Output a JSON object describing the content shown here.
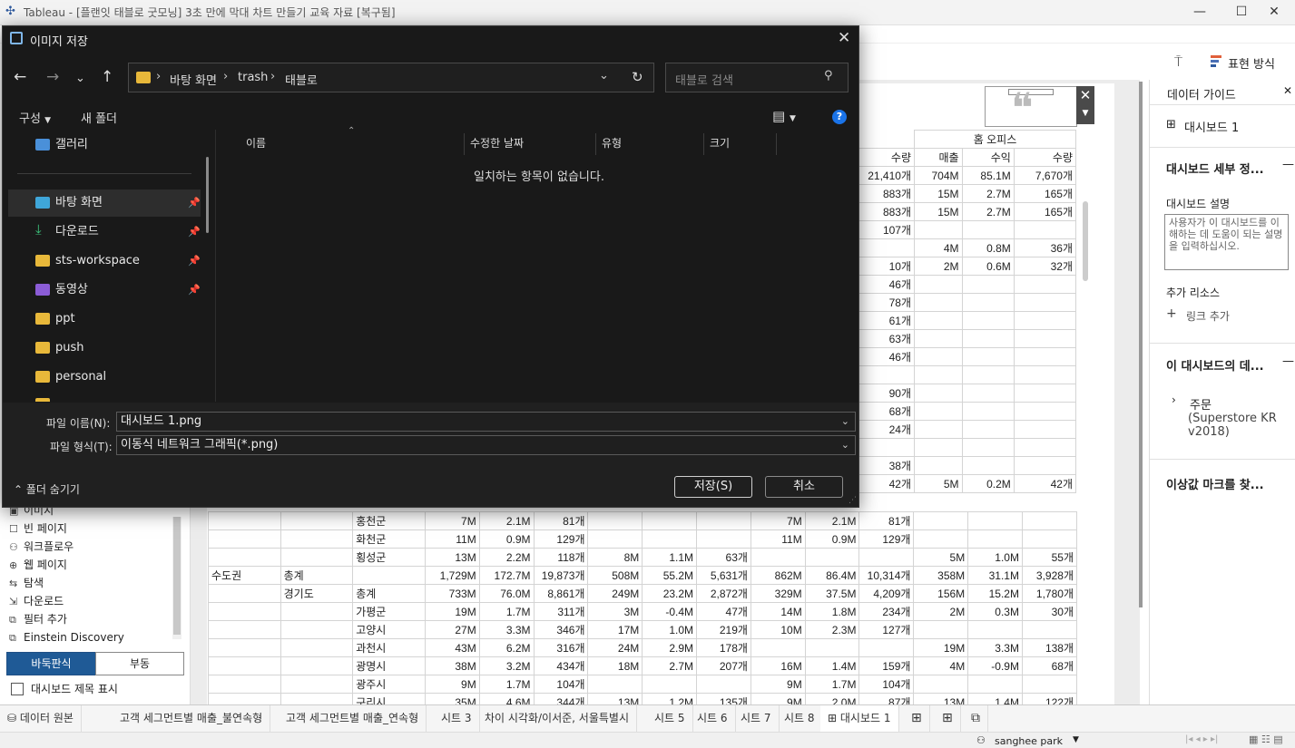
{
  "window": {
    "title": "Tableau - [플랜잇 태블로 굿모닝] 3초 만에 막대 차트 만들기 교육 자료 [복구됨]",
    "controls": [
      "—",
      "☐",
      "✕"
    ]
  },
  "toolbar": {
    "present_label": "표현 방식"
  },
  "left_pane": {
    "objects": [
      "이미지",
      "빈 페이지",
      "워크플로우",
      "웹 페이지",
      "탐색",
      "다운로드",
      "필터 추가",
      "Einstein Discovery"
    ],
    "tiled": "바둑판식",
    "floating": "부동",
    "show_title": "대시보드 제목 표시"
  },
  "table": {
    "group_header": "홈 오피스",
    "col_headers": [
      "수량",
      "매출",
      "수익",
      "수량"
    ],
    "top_rows": [
      [
        "21,410개",
        "704M",
        "85.1M",
        "7,670개"
      ],
      [
        "883개",
        "15M",
        "2.7M",
        "165개"
      ],
      [
        "883개",
        "15M",
        "2.7M",
        "165개"
      ],
      [
        "107개",
        "",
        "",
        ""
      ],
      [
        "",
        "4M",
        "0.8M",
        "36개"
      ],
      [
        "10개",
        "2M",
        "0.6M",
        "32개"
      ],
      [
        "46개",
        "",
        "",
        ""
      ],
      [
        "78개",
        "",
        "",
        ""
      ],
      [
        "61개",
        "",
        "",
        ""
      ],
      [
        "63개",
        "",
        "",
        ""
      ],
      [
        "46개",
        "",
        "",
        ""
      ],
      [
        "",
        "",
        "",
        ""
      ],
      [
        "90개",
        "",
        "",
        ""
      ],
      [
        "68개",
        "",
        "",
        ""
      ],
      [
        "24개",
        "",
        "",
        ""
      ],
      [
        "",
        "",
        "",
        ""
      ],
      [
        "38개",
        "",
        "",
        ""
      ],
      [
        "42개",
        "5M",
        "0.2M",
        "42개"
      ]
    ],
    "bottom_rows": [
      {
        "c1": "",
        "c2": "",
        "c3": "홍천군",
        "v": [
          "7M",
          "2.1M",
          "81개",
          "",
          "",
          "",
          "7M",
          "2.1M",
          "81개",
          "",
          "",
          ""
        ]
      },
      {
        "c1": "",
        "c2": "",
        "c3": "화천군",
        "v": [
          "11M",
          "0.9M",
          "129개",
          "",
          "",
          "",
          "11M",
          "0.9M",
          "129개",
          "",
          "",
          ""
        ]
      },
      {
        "c1": "",
        "c2": "",
        "c3": "횡성군",
        "v": [
          "13M",
          "2.2M",
          "118개",
          "8M",
          "1.1M",
          "63개",
          "",
          "",
          "",
          "5M",
          "1.0M",
          "55개"
        ]
      },
      {
        "c1": "수도권",
        "c2": "총계",
        "c3": "",
        "v": [
          "1,729M",
          "172.7M",
          "19,873개",
          "508M",
          "55.2M",
          "5,631개",
          "862M",
          "86.4M",
          "10,314개",
          "358M",
          "31.1M",
          "3,928개"
        ]
      },
      {
        "c1": "",
        "c2": "경기도",
        "c3": "총계",
        "v": [
          "733M",
          "76.0M",
          "8,861개",
          "249M",
          "23.2M",
          "2,872개",
          "329M",
          "37.5M",
          "4,209개",
          "156M",
          "15.2M",
          "1,780개"
        ]
      },
      {
        "c1": "",
        "c2": "",
        "c3": "가평군",
        "v": [
          "19M",
          "1.7M",
          "311개",
          "3M",
          "-0.4M",
          "47개",
          "14M",
          "1.8M",
          "234개",
          "2M",
          "0.3M",
          "30개"
        ]
      },
      {
        "c1": "",
        "c2": "",
        "c3": "고양시",
        "v": [
          "27M",
          "3.3M",
          "346개",
          "17M",
          "1.0M",
          "219개",
          "10M",
          "2.3M",
          "127개",
          "",
          "",
          ""
        ]
      },
      {
        "c1": "",
        "c2": "",
        "c3": "과천시",
        "v": [
          "43M",
          "6.2M",
          "316개",
          "24M",
          "2.9M",
          "178개",
          "",
          "",
          "",
          "19M",
          "3.3M",
          "138개"
        ]
      },
      {
        "c1": "",
        "c2": "",
        "c3": "광명시",
        "v": [
          "38M",
          "3.2M",
          "434개",
          "18M",
          "2.7M",
          "207개",
          "16M",
          "1.4M",
          "159개",
          "4M",
          "-0.9M",
          "68개"
        ]
      },
      {
        "c1": "",
        "c2": "",
        "c3": "광주시",
        "v": [
          "9M",
          "1.7M",
          "104개",
          "",
          "",
          "",
          "9M",
          "1.7M",
          "104개",
          "",
          "",
          ""
        ]
      },
      {
        "c1": "",
        "c2": "",
        "c3": "구리시",
        "v": [
          "35M",
          "4.6M",
          "344개",
          "13M",
          "1.2M",
          "135개",
          "9M",
          "2.0M",
          "87개",
          "13M",
          "1.4M",
          "122개"
        ]
      }
    ]
  },
  "right_pane": {
    "tab": "데이터 가이드",
    "dashboard": "대시보드 1",
    "details_header": "대시보드 세부 정...",
    "desc_label": "대시보드 설명",
    "desc_placeholder": "사용자가 이 대시보드를 이해하는 데 도움이 되는 설명을 입력하십시오.",
    "more_resources": "추가 리소스",
    "add_link": "링크 추가",
    "data_header": "이 대시보드의 데...",
    "datasource_name": "주문",
    "datasource_sub": "(Superstore KR v2018)",
    "outlier_header": "이상값 마크를 찾..."
  },
  "tabs": [
    "데이터 원본",
    "고객 세그먼트별 매출_불연속형",
    "고객 세그먼트별 매출_연속형",
    "시트 3",
    "차이 시각화/이서준, 서울특별시",
    "시트 5",
    "시트 6",
    "시트 7",
    "시트 8",
    "대시보드 1"
  ],
  "status": {
    "user": "sanghee park"
  },
  "dialog": {
    "title": "이미지 저장",
    "breadcrumb": [
      "바탕 화면",
      "trash",
      "태블로"
    ],
    "search_placeholder": "태블로 검색",
    "organize": "구성",
    "new_folder": "새 폴더",
    "sidebar": [
      {
        "label": "갤러리",
        "pinned": false
      },
      {
        "label": "바탕 화면",
        "pinned": true
      },
      {
        "label": "다운로드",
        "pinned": true
      },
      {
        "label": "sts-workspace",
        "pinned": true
      },
      {
        "label": "동영상",
        "pinned": true
      },
      {
        "label": "ppt",
        "pinned": false
      },
      {
        "label": "push",
        "pinned": false
      },
      {
        "label": "personal",
        "pinned": false
      }
    ],
    "columns": [
      "이름",
      "수정한 날짜",
      "유형",
      "크기"
    ],
    "empty_message": "일치하는 항목이 없습니다.",
    "filename_label": "파일 이름(N):",
    "filename_value": "대시보드 1.png",
    "filetype_label": "파일 형식(T):",
    "filetype_value": "이동식 네트워크 그래픽(*.png)",
    "hide_folders": "폴더 숨기기",
    "save": "저장(S)",
    "cancel": "취소"
  }
}
